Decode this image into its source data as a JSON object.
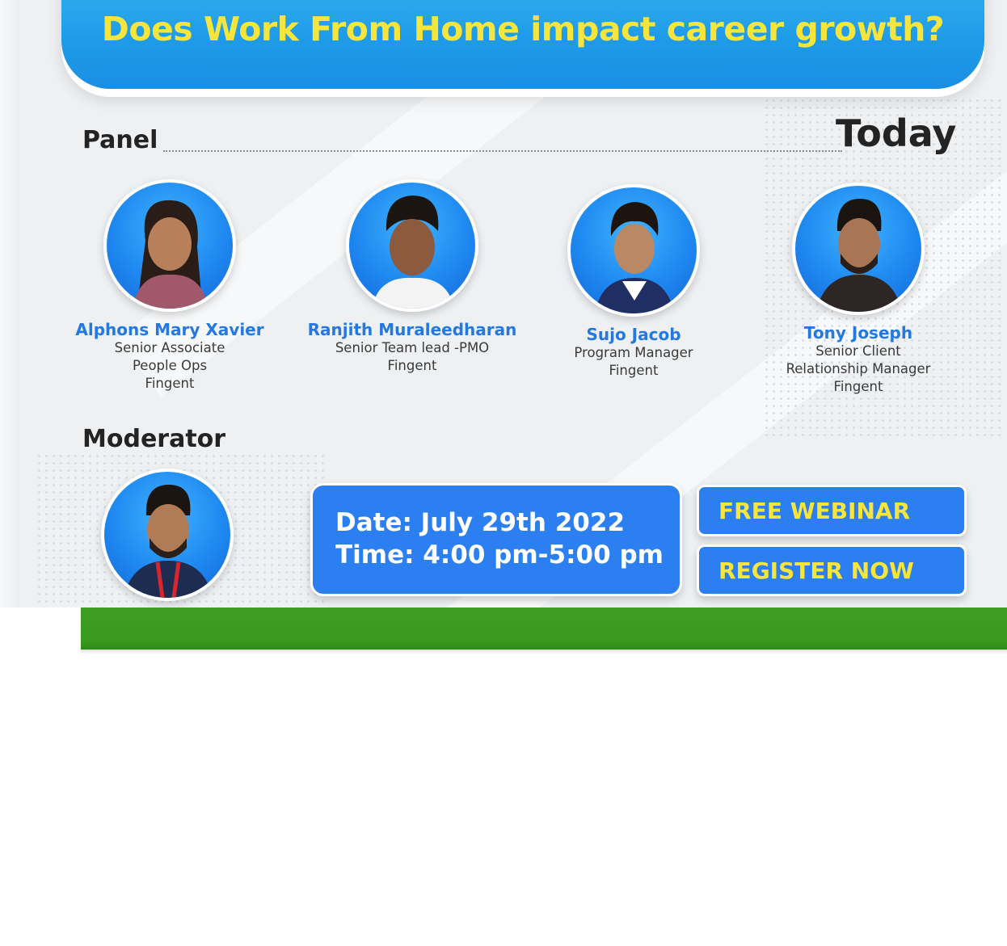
{
  "banner": {
    "title": "Does Work From Home impact career growth?"
  },
  "sections": {
    "panel_label": "Panel",
    "today_label": "Today",
    "moderator_label": "Moderator"
  },
  "panel": [
    {
      "name": "Alphons Mary Xavier",
      "lines": [
        "Senior Associate",
        "People Ops",
        "Fingent"
      ]
    },
    {
      "name": "Ranjith Muraleedharan",
      "lines": [
        "Senior Team lead -PMO",
        "Fingent"
      ]
    },
    {
      "name": "Sujo Jacob",
      "lines": [
        "Program Manager",
        "Fingent"
      ]
    },
    {
      "name": "Tony Joseph",
      "lines": [
        "Senior Client",
        "Relationship Manager",
        "Fingent"
      ]
    }
  ],
  "event": {
    "date": "Date: July 29th 2022",
    "time": "Time: 4:00 pm-5:00 pm"
  },
  "cta": {
    "free_webinar": "FREE WEBINAR",
    "register_now": "REGISTER NOW"
  },
  "colors": {
    "accent_blue": "#2b7ff0",
    "banner_blue": "#1e9be8",
    "headline_yellow": "#f5e53c",
    "name_blue": "#2478e0",
    "footer_green": "#3f9d22"
  }
}
